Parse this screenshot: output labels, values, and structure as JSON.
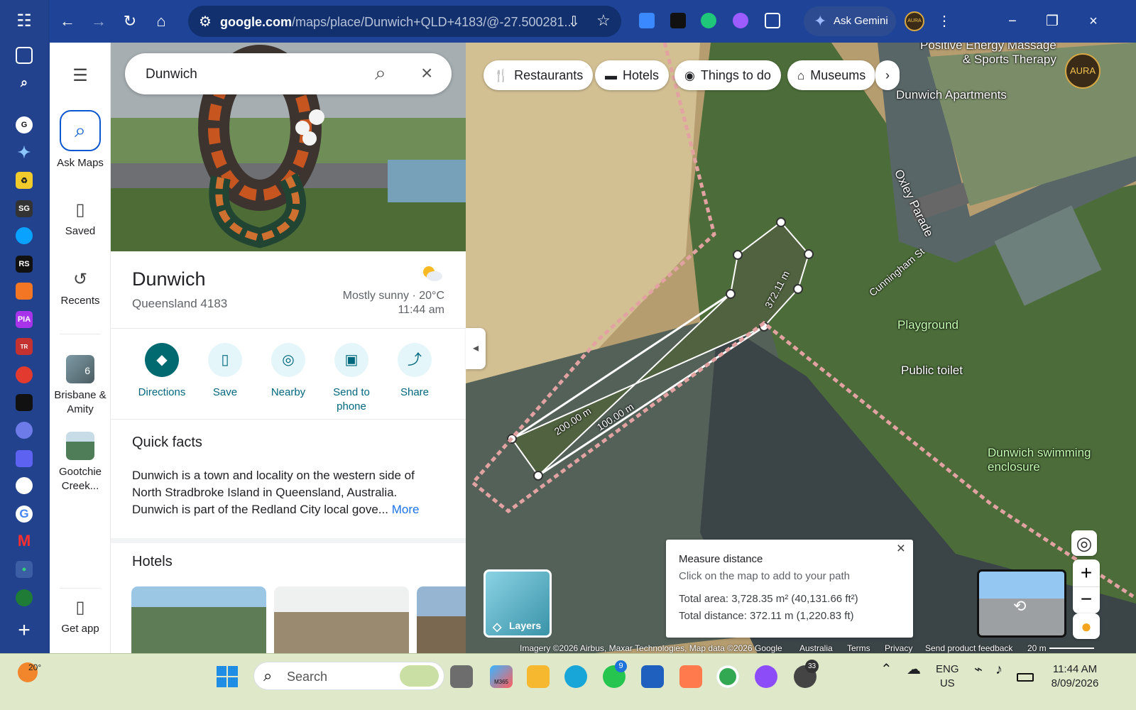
{
  "browser": {
    "url_host": "google.com",
    "url_path": "/maps/place/Dunwich+QLD+4183/@-27.500281...",
    "gemini_label": "Ask Gemini",
    "profile": "AURA"
  },
  "maps_rail": {
    "ask": "Ask Maps",
    "saved": "Saved",
    "recents": "Recents",
    "recent1": "Brisbane & Amity",
    "recent1_badge": "6",
    "recent2": "Gootchie Creek...",
    "get_app": "Get app"
  },
  "place": {
    "search_value": "Dunwich",
    "title": "Dunwich",
    "subtitle": "Queensland 4183",
    "weather": "Mostly sunny · 20°C",
    "time": "11:44 am"
  },
  "actions": {
    "directions": "Directions",
    "save": "Save",
    "nearby": "Nearby",
    "send": "Send to",
    "phone": "phone",
    "share": "Share"
  },
  "quick_facts": {
    "heading": "Quick facts",
    "text": "Dunwich is a town and locality on the western side of North Stradbroke Island in Queensland, Australia. Dunwich is part of the Redland City local gove...",
    "more": "More"
  },
  "hotels_heading": "Hotels",
  "map": {
    "chips": [
      "Restaurants",
      "Hotels",
      "Things to do",
      "Museums"
    ],
    "labels": {
      "therapy_1": "Positive Energy Massage",
      "therapy_2": "& Sports Therapy",
      "apartments": "Dunwich Apartments",
      "oxley": "Oxley Parade",
      "cunningham": "Cunningham St",
      "playground": "Playground",
      "toilet": "Public toilet",
      "swimming_1": "Dunwich swimming",
      "swimming_2": "enclosure",
      "measure_a": "372.11 m",
      "measure_b": "200.00 m",
      "measure_c": "100.00 m"
    },
    "profile_badge": "AURA"
  },
  "measure": {
    "title": "Measure distance",
    "hint": "Click on the map to add to your path",
    "area": "Total area: 3,728.35 m² (40,131.66 ft²)",
    "distance": "Total distance: 372.11 m (1,220.83 ft)"
  },
  "map_controls": {
    "layers": "Layers",
    "zoom_in": "+",
    "zoom_out": "−"
  },
  "footer": {
    "imagery": "Imagery ©2026 Airbus, Maxar Technologies, Map data ©2026 Google",
    "country": "Australia",
    "terms": "Terms",
    "privacy": "Privacy",
    "feedback": "Send product feedback",
    "scale": "20 m"
  },
  "taskbar": {
    "temperature": "20°",
    "search": "Search",
    "whatsapp_badge": "9",
    "chatgpt_badge": "33",
    "lang1": "ENG",
    "lang2": "US",
    "time": "11:44 AM",
    "date": "8/09/2026",
    "m365": "M365"
  }
}
